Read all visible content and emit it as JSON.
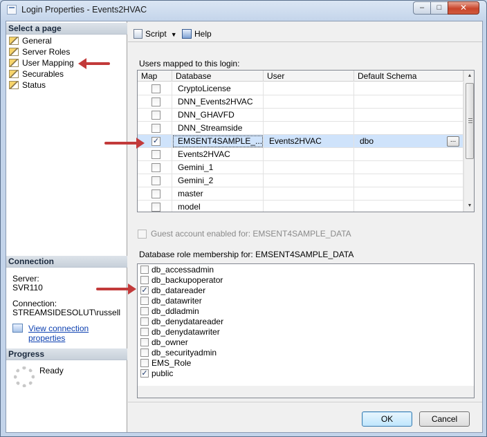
{
  "window": {
    "title": "Login Properties - Events2HVAC",
    "minimize_glyph": "–",
    "maximize_glyph": "□",
    "close_glyph": "✕"
  },
  "sidebar": {
    "select_page_header": "Select a page",
    "pages": [
      {
        "label": "General",
        "icon": "page-icon"
      },
      {
        "label": "Server Roles",
        "icon": "page-icon"
      },
      {
        "label": "User Mapping",
        "icon": "page-icon"
      },
      {
        "label": "Securables",
        "icon": "page-icon"
      },
      {
        "label": "Status",
        "icon": "page-icon"
      }
    ],
    "connection_header": "Connection",
    "server_label": "Server:",
    "server_value": "SVR110",
    "connection_label": "Connection:",
    "connection_value": "STREAMSIDESOLUT\\russell",
    "view_link": "View connection properties",
    "progress_header": "Progress",
    "progress_status": "Ready"
  },
  "toolbar": {
    "script_label": "Script",
    "script_caret": "▼",
    "help_label": "Help"
  },
  "users_mapped": {
    "label": "Users mapped to this login:",
    "columns": [
      "Map",
      "Database",
      "User",
      "Default Schema"
    ],
    "rows": [
      {
        "checked": false,
        "database": "CryptoLicense",
        "user": "",
        "schema": ""
      },
      {
        "checked": false,
        "database": "DNN_Events2HVAC",
        "user": "",
        "schema": ""
      },
      {
        "checked": false,
        "database": "DNN_GHAVFD",
        "user": "",
        "schema": ""
      },
      {
        "checked": false,
        "database": "DNN_Streamside",
        "user": "",
        "schema": ""
      },
      {
        "checked": true,
        "database": "EMSENT4SAMPLE_...",
        "user": "Events2HVAC",
        "schema": "dbo",
        "selected": true
      },
      {
        "checked": false,
        "database": "Events2HVAC",
        "user": "",
        "schema": ""
      },
      {
        "checked": false,
        "database": "Gemini_1",
        "user": "",
        "schema": ""
      },
      {
        "checked": false,
        "database": "Gemini_2",
        "user": "",
        "schema": ""
      },
      {
        "checked": false,
        "database": "master",
        "user": "",
        "schema": ""
      },
      {
        "checked": false,
        "database": "model",
        "user": "",
        "schema": ""
      }
    ],
    "ellipsis": "..."
  },
  "guest": {
    "label": "Guest account enabled for: EMSENT4SAMPLE_DATA",
    "checked": false
  },
  "role_membership": {
    "label": "Database role membership for: EMSENT4SAMPLE_DATA",
    "roles": [
      {
        "name": "db_accessadmin",
        "checked": false
      },
      {
        "name": "db_backupoperator",
        "checked": false
      },
      {
        "name": "db_datareader",
        "checked": true
      },
      {
        "name": "db_datawriter",
        "checked": false
      },
      {
        "name": "db_ddladmin",
        "checked": false
      },
      {
        "name": "db_denydatareader",
        "checked": false
      },
      {
        "name": "db_denydatawriter",
        "checked": false
      },
      {
        "name": "db_owner",
        "checked": false
      },
      {
        "name": "db_securityadmin",
        "checked": false
      },
      {
        "name": "EMS_Role",
        "checked": false
      },
      {
        "name": "public",
        "checked": true
      }
    ]
  },
  "buttons": {
    "ok": "OK",
    "cancel": "Cancel"
  },
  "colors": {
    "annotation_arrow": "#c23a3a",
    "selected_row": "#cfe3fb",
    "link": "#0b3fb0"
  }
}
